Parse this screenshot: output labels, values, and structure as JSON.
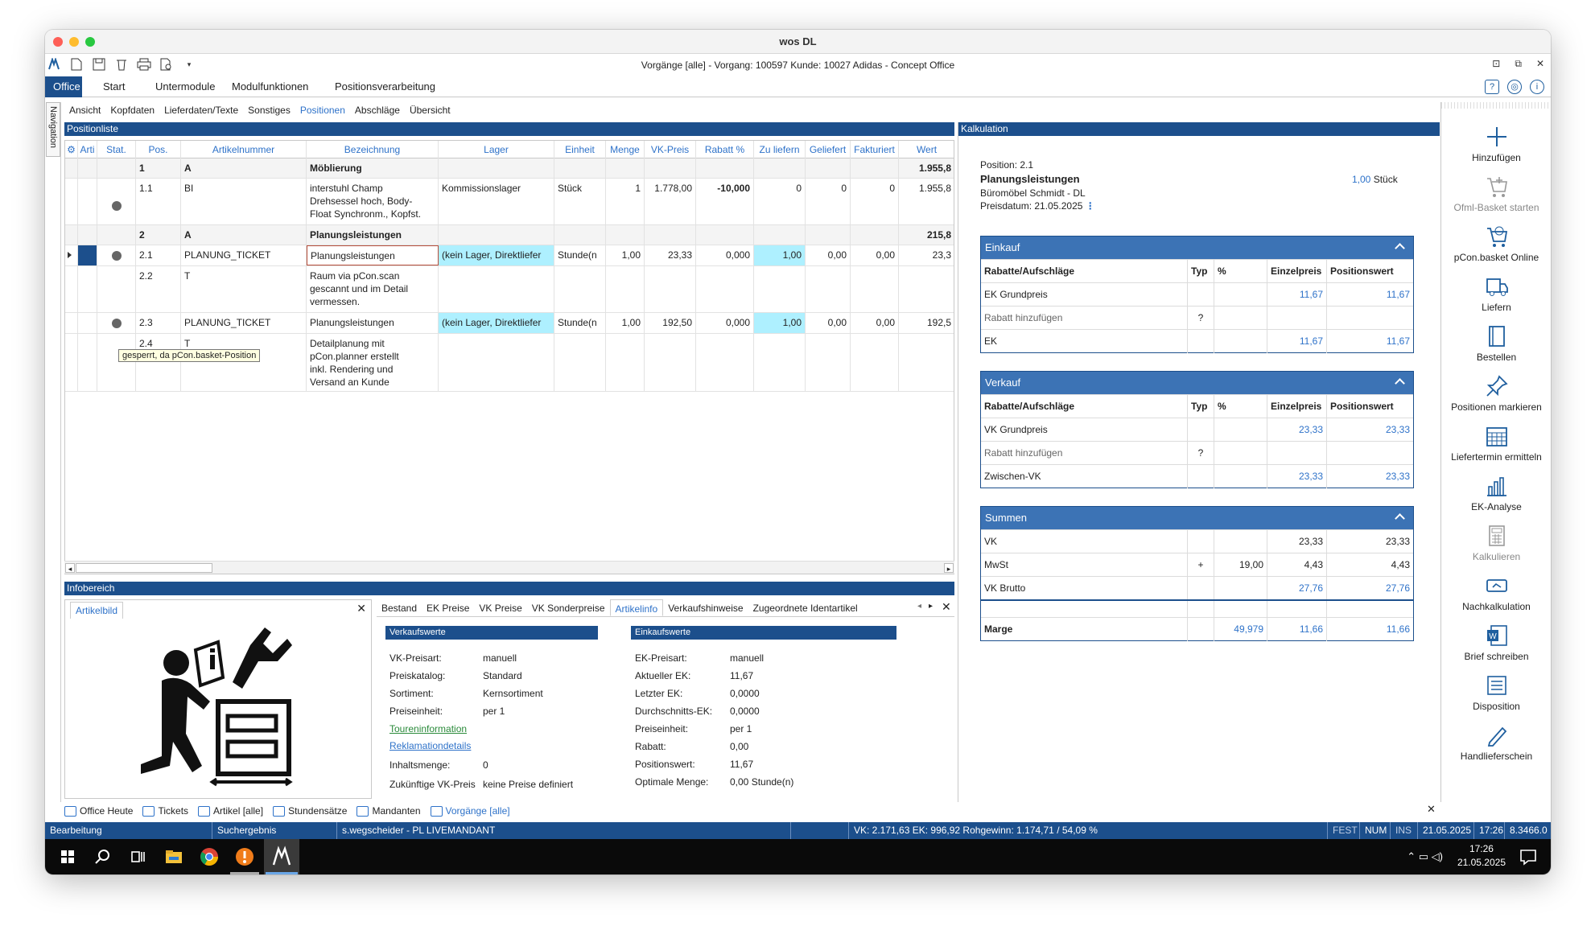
{
  "window": {
    "mac_title": "wos DL",
    "app_title": "Vorgänge [alle] - Vorgang: 100597 Kunde: 10027 Adidas - Concept Office"
  },
  "ribbon": {
    "tabs": [
      "Office",
      "Start",
      "Untermodule",
      "Modulfunktionen",
      "Positionsverarbeitung"
    ]
  },
  "navigation_label": "Navigation",
  "subnav": [
    "Ansicht",
    "Kopfdaten",
    "Lieferdaten/Texte",
    "Sonstiges",
    "Positionen",
    "Abschläge",
    "Übersicht"
  ],
  "positionliste": {
    "title": "Positionliste",
    "columns": [
      "Arti",
      "Stat.",
      "Pos.",
      "Artikelnummer",
      "Bezeichnung",
      "Lager",
      "Einheit",
      "Menge",
      "VK-Preis",
      "Rabatt %",
      "Zu liefern",
      "Geliefert",
      "Fakturiert",
      "Wert"
    ],
    "rows": [
      {
        "pos": "1",
        "artnr": "A",
        "bez": "Möblierung",
        "lager": "",
        "einheit": "",
        "menge": "",
        "vk": "",
        "rabatt": "",
        "zul": "",
        "gel": "",
        "fakt": "",
        "wert": "1.955,8"
      },
      {
        "pos": "1.1",
        "artnr": "BI",
        "bez": "interstuhl Champ\nDrehsessel hoch, Body-\nFloat Synchronm., Kopfst.",
        "lager": "Kommissionslager",
        "einheit": "Stück",
        "menge": "1",
        "vk": "1.778,00",
        "rabatt": "-10,000",
        "zul": "0",
        "gel": "0",
        "fakt": "0",
        "wert": "1.955,8"
      },
      {
        "pos": "2",
        "artnr": "A",
        "bez": "Planungsleistungen",
        "lager": "",
        "einheit": "",
        "menge": "",
        "vk": "",
        "rabatt": "",
        "zul": "",
        "gel": "",
        "fakt": "",
        "wert": "215,8"
      },
      {
        "pos": "2.1",
        "artnr": "PLANUNG_TICKET",
        "bez": "Planungsleistungen",
        "lager": "(kein Lager, Direktliefer",
        "einheit": "Stunde(n",
        "menge": "1,00",
        "vk": "23,33",
        "rabatt": "0,000",
        "zul": "1,00",
        "gel": "0,00",
        "fakt": "0,00",
        "wert": "23,3"
      },
      {
        "pos": "2.2",
        "artnr": "T",
        "bez": "Raum via pCon.scan\ngescannt und im Detail\nvermessen.",
        "lager": "",
        "einheit": "",
        "menge": "",
        "vk": "",
        "rabatt": "",
        "zul": "",
        "gel": "",
        "fakt": "",
        "wert": ""
      },
      {
        "pos": "2.3",
        "artnr": "PLANUNG_TICKET",
        "bez": "Planungsleistungen",
        "lager": "(kein Lager, Direktliefer",
        "einheit": "Stunde(n",
        "menge": "1,00",
        "vk": "192,50",
        "rabatt": "0,000",
        "zul": "1,00",
        "gel": "0,00",
        "fakt": "0,00",
        "wert": "192,5"
      },
      {
        "pos": "2.4",
        "artnr": "T",
        "bez": "Detailplanung mit\npCon.planner erstellt\ninkl. Rendering und\nVersand an Kunde",
        "lager": "",
        "einheit": "",
        "menge": "",
        "vk": "",
        "rabatt": "",
        "zul": "",
        "gel": "",
        "fakt": "",
        "wert": ""
      }
    ],
    "tooltip": "gesperrt, da pCon.basket-Position"
  },
  "infobereich": {
    "title": "Infobereich",
    "artikelbild_tab": "Artikelbild",
    "tabs": [
      "Bestand",
      "EK Preise",
      "VK Preise",
      "VK Sonderpreise",
      "Artikelinfo",
      "Verkaufshinweise",
      "Zugeordnete Identartikel"
    ],
    "verkaufswerte": {
      "title": "Verkaufswerte",
      "items": [
        {
          "k": "VK-Preisart:",
          "v": "manuell"
        },
        {
          "k": "Preiskatalog:",
          "v": "Standard"
        },
        {
          "k": "Sortiment:",
          "v": "Kernsortiment"
        },
        {
          "k": "Preiseinheit:",
          "v": "per 1"
        }
      ],
      "link_tour": "Toureninformation",
      "link_rekl": "Reklamationdetails",
      "inhaltsmenge_k": "Inhaltsmenge:",
      "inhaltsmenge_v": "0",
      "zukunft_k": "Zukünftige VK-Preis",
      "zukunft_v": "keine Preise definiert"
    },
    "einkaufswerte": {
      "title": "Einkaufswerte",
      "items": [
        {
          "k": "EK-Preisart:",
          "v": "manuell"
        },
        {
          "k": "Aktueller EK:",
          "v": "11,67"
        },
        {
          "k": "Letzter EK:",
          "v": "0,0000"
        },
        {
          "k": "Durchschnitts-EK:",
          "v": "0,0000"
        },
        {
          "k": "Preiseinheit:",
          "v": "per 1"
        },
        {
          "k": "Rabatt:",
          "v": "0,00"
        },
        {
          "k": "Positionswert:",
          "v": "11,67"
        },
        {
          "k": "Optimale Menge:",
          "v": "0,00 Stunde(n)"
        }
      ]
    }
  },
  "kalkulation": {
    "title": "Kalkulation",
    "position": "Position: 2.1",
    "name": "Planungsleistungen",
    "qty": "1,00",
    "unit": "Stück",
    "supplier": "Büromöbel Schmidt - DL",
    "preisdatum": "Preisdatum: 21.05.2025",
    "table_headers": [
      "Rabatte/Aufschläge",
      "Typ",
      "%",
      "Einzelpreis",
      "Positionswert"
    ],
    "einkauf": {
      "title": "Einkauf",
      "rows": [
        {
          "label": "EK Grundpreis",
          "typ": "",
          "pct": "",
          "ep": "11,67",
          "pw": "11,67",
          "kind": "blue"
        },
        {
          "label": "Rabatt hinzufügen",
          "typ": "?",
          "pct": "",
          "ep": "",
          "pw": "",
          "kind": "grey"
        },
        {
          "label": "EK",
          "typ": "",
          "pct": "",
          "ep": "11,67",
          "pw": "11,67",
          "kind": "blue"
        }
      ]
    },
    "verkauf": {
      "title": "Verkauf",
      "rows": [
        {
          "label": "VK Grundpreis",
          "typ": "",
          "pct": "",
          "ep": "23,33",
          "pw": "23,33",
          "kind": "blue"
        },
        {
          "label": "Rabatt hinzufügen",
          "typ": "?",
          "pct": "",
          "ep": "",
          "pw": "",
          "kind": "grey"
        },
        {
          "label": "Zwischen-VK",
          "typ": "",
          "pct": "",
          "ep": "23,33",
          "pw": "23,33",
          "kind": "blue"
        }
      ]
    },
    "summen": {
      "title": "Summen",
      "rows": [
        {
          "label": "VK",
          "typ": "",
          "pct": "",
          "ep": "23,33",
          "pw": "23,33",
          "kind": "plain"
        },
        {
          "label": "MwSt",
          "typ": "+",
          "pct": "19,00",
          "ep": "4,43",
          "pw": "4,43",
          "kind": "plain"
        },
        {
          "label": "VK Brutto",
          "typ": "",
          "pct": "",
          "ep": "27,76",
          "pw": "27,76",
          "kind": "blue"
        },
        {
          "label": "",
          "typ": "",
          "pct": "",
          "ep": "",
          "pw": "",
          "kind": "plain"
        },
        {
          "label": "Marge",
          "typ": "",
          "pct": "49,979",
          "ep": "11,66",
          "pw": "11,66",
          "kind": "marge"
        }
      ]
    }
  },
  "right_toolbar": [
    {
      "label": "Hinzufügen",
      "icon": "plus-icon",
      "enabled": true
    },
    {
      "label": "Ofml-Basket starten",
      "icon": "cart-add-icon",
      "enabled": false
    },
    {
      "label": "pCon.basket Online",
      "icon": "cart-online-icon",
      "enabled": true
    },
    {
      "label": "Liefern",
      "icon": "truck-icon",
      "enabled": true
    },
    {
      "label": "Bestellen",
      "icon": "order-icon",
      "enabled": true
    },
    {
      "label": "Positionen markieren",
      "icon": "pin-icon",
      "enabled": true
    },
    {
      "label": "Liefertermin ermitteln",
      "icon": "calendar-icon",
      "enabled": true
    },
    {
      "label": "EK-Analyse",
      "icon": "bar-chart-icon",
      "enabled": true
    },
    {
      "label": "Kalkulieren",
      "icon": "calculator-icon",
      "enabled": false
    },
    {
      "label": "Nachkalkulation",
      "icon": "recalc-icon",
      "enabled": true
    },
    {
      "label": "Brief schreiben",
      "icon": "word-icon",
      "enabled": true
    },
    {
      "label": "Disposition",
      "icon": "list-icon",
      "enabled": true
    },
    {
      "label": "Handlieferschein",
      "icon": "pencil-icon",
      "enabled": true
    }
  ],
  "bottom_nav": [
    {
      "label": "Office Heute",
      "icon": "office-today-icon",
      "active": false
    },
    {
      "label": "Tickets",
      "icon": "tickets-icon",
      "active": false
    },
    {
      "label": "Artikel [alle]",
      "icon": "article-icon",
      "active": false
    },
    {
      "label": "Stundensätze",
      "icon": "hours-icon",
      "active": false
    },
    {
      "label": "Mandanten",
      "icon": "clients-icon",
      "active": false
    },
    {
      "label": "Vorgänge [alle]",
      "icon": "processes-icon",
      "active": true
    }
  ],
  "statusbar": {
    "mode": "Bearbeitung",
    "search": "Suchergebnis",
    "user": "s.wegscheider - PL LIVEMANDANT",
    "totals": "VK: 2.171,63 EK: 996,92 Rohgewinn: 1.174,71 / 54,09 %",
    "fest": "FEST",
    "num": "NUM",
    "ins": "INS",
    "date": "21.05.2025",
    "time": "17:26",
    "version": "8.3466.0"
  },
  "taskbar": {
    "time": "17:26",
    "date": "21.05.2025"
  }
}
